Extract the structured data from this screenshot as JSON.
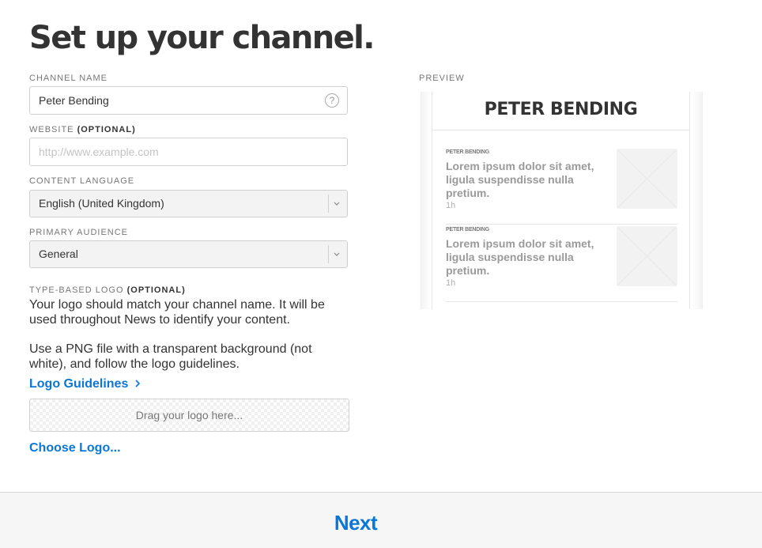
{
  "page": {
    "title": "Set up your channel."
  },
  "form": {
    "channel_name": {
      "label": "CHANNEL NAME",
      "value": "Peter Bending",
      "help_icon": "?"
    },
    "website": {
      "label": "WEBSITE",
      "optional": "(OPTIONAL)",
      "placeholder": "http://www.example.com",
      "value": ""
    },
    "content_language": {
      "label": "CONTENT LANGUAGE",
      "value": "English (United Kingdom)"
    },
    "primary_audience": {
      "label": "PRIMARY AUDIENCE",
      "value": "General"
    },
    "logo": {
      "label": "TYPE-BASED LOGO",
      "optional": "(OPTIONAL)",
      "description_1": "Your logo should match your channel name. It will be used throughout News to identify your content.",
      "description_2": "Use a PNG file with a transparent background (not white), and follow the logo guidelines.",
      "guidelines_link": "Logo Guidelines",
      "dropzone_text": "Drag your logo here...",
      "choose_link": "Choose Logo..."
    }
  },
  "preview": {
    "label": "PREVIEW",
    "channel_title": "PETER BENDING",
    "items": [
      {
        "source": "PETER BENDING",
        "headline": "Lorem ipsum dolor sit amet, ligula suspendisse nulla pretium.",
        "time": "1h"
      },
      {
        "source": "PETER BENDING",
        "headline": "Lorem ipsum dolor sit amet, ligula suspendisse nulla pretium.",
        "time": "1h"
      }
    ]
  },
  "footer": {
    "next_label": "Next"
  },
  "colors": {
    "accent": "#0a76d8",
    "text": "#333333",
    "muted": "#777777",
    "footer_bg": "#f6f6f6"
  },
  "icons": {
    "help": "help-icon",
    "chevron": "chevron-down-icon",
    "guidelines_arrow": "chevron-right-icon",
    "thumbnail": "image-placeholder-icon"
  }
}
